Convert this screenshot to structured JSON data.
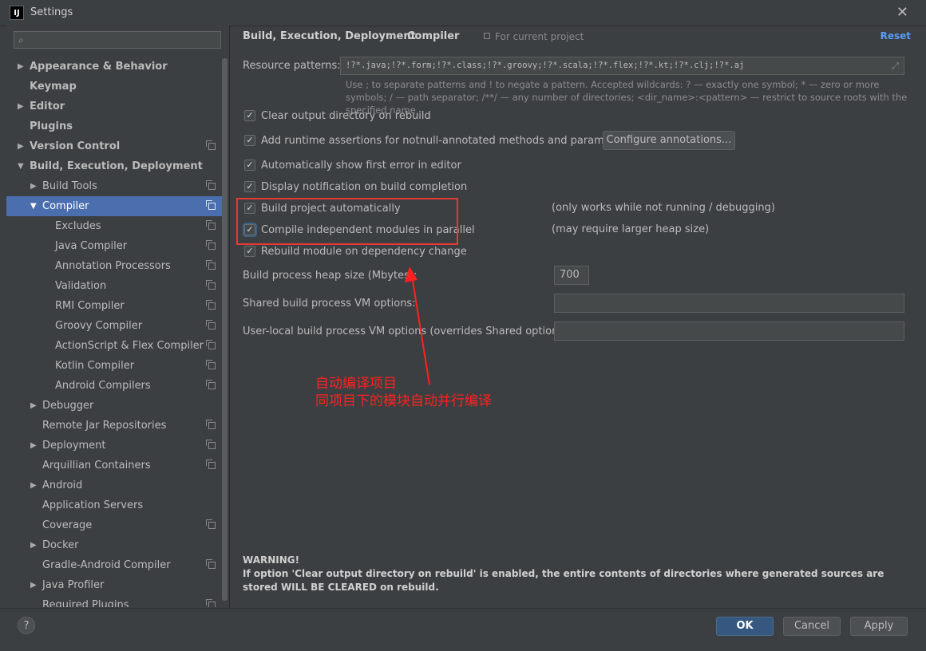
{
  "window": {
    "title": "Settings",
    "app_icon": "IJ"
  },
  "sidebar": {
    "search_placeholder": "",
    "items": [
      {
        "label": "Appearance & Behavior",
        "level": 0,
        "bold": true,
        "arrow": "▶",
        "copy": false,
        "selected": false
      },
      {
        "label": "Keymap",
        "level": 0,
        "bold": true,
        "arrow": "",
        "copy": false,
        "selected": false
      },
      {
        "label": "Editor",
        "level": 0,
        "bold": true,
        "arrow": "▶",
        "copy": false,
        "selected": false
      },
      {
        "label": "Plugins",
        "level": 0,
        "bold": true,
        "arrow": "",
        "copy": false,
        "selected": false
      },
      {
        "label": "Version Control",
        "level": 0,
        "bold": true,
        "arrow": "▶",
        "copy": true,
        "selected": false
      },
      {
        "label": "Build, Execution, Deployment",
        "level": 0,
        "bold": true,
        "arrow": "▼",
        "copy": false,
        "selected": false
      },
      {
        "label": "Build Tools",
        "level": 1,
        "bold": false,
        "arrow": "▶",
        "copy": true,
        "selected": false
      },
      {
        "label": "Compiler",
        "level": 1,
        "bold": false,
        "arrow": "▼",
        "copy": true,
        "selected": true
      },
      {
        "label": "Excludes",
        "level": 2,
        "bold": false,
        "arrow": "",
        "copy": true,
        "selected": false
      },
      {
        "label": "Java Compiler",
        "level": 2,
        "bold": false,
        "arrow": "",
        "copy": true,
        "selected": false
      },
      {
        "label": "Annotation Processors",
        "level": 2,
        "bold": false,
        "arrow": "",
        "copy": true,
        "selected": false
      },
      {
        "label": "Validation",
        "level": 2,
        "bold": false,
        "arrow": "",
        "copy": true,
        "selected": false
      },
      {
        "label": "RMI Compiler",
        "level": 2,
        "bold": false,
        "arrow": "",
        "copy": true,
        "selected": false
      },
      {
        "label": "Groovy Compiler",
        "level": 2,
        "bold": false,
        "arrow": "",
        "copy": true,
        "selected": false
      },
      {
        "label": "ActionScript & Flex Compiler",
        "level": 2,
        "bold": false,
        "arrow": "",
        "copy": true,
        "selected": false
      },
      {
        "label": "Kotlin Compiler",
        "level": 2,
        "bold": false,
        "arrow": "",
        "copy": true,
        "selected": false
      },
      {
        "label": "Android Compilers",
        "level": 2,
        "bold": false,
        "arrow": "",
        "copy": true,
        "selected": false
      },
      {
        "label": "Debugger",
        "level": 1,
        "bold": false,
        "arrow": "▶",
        "copy": false,
        "selected": false
      },
      {
        "label": "Remote Jar Repositories",
        "level": 1,
        "bold": false,
        "arrow": "",
        "copy": true,
        "selected": false
      },
      {
        "label": "Deployment",
        "level": 1,
        "bold": false,
        "arrow": "▶",
        "copy": true,
        "selected": false
      },
      {
        "label": "Arquillian Containers",
        "level": 1,
        "bold": false,
        "arrow": "",
        "copy": true,
        "selected": false
      },
      {
        "label": "Android",
        "level": 1,
        "bold": false,
        "arrow": "▶",
        "copy": false,
        "selected": false
      },
      {
        "label": "Application Servers",
        "level": 1,
        "bold": false,
        "arrow": "",
        "copy": false,
        "selected": false
      },
      {
        "label": "Coverage",
        "level": 1,
        "bold": false,
        "arrow": "",
        "copy": true,
        "selected": false
      },
      {
        "label": "Docker",
        "level": 1,
        "bold": false,
        "arrow": "▶",
        "copy": false,
        "selected": false
      },
      {
        "label": "Gradle-Android Compiler",
        "level": 1,
        "bold": false,
        "arrow": "",
        "copy": true,
        "selected": false
      },
      {
        "label": "Java Profiler",
        "level": 1,
        "bold": false,
        "arrow": "▶",
        "copy": false,
        "selected": false
      },
      {
        "label": "Required Plugins",
        "level": 1,
        "bold": false,
        "arrow": "",
        "copy": true,
        "selected": false
      }
    ]
  },
  "header": {
    "breadcrumb_parent": "Build, Execution, Deployment",
    "breadcrumb_sep": "›",
    "breadcrumb_current": "Compiler",
    "scope_label": "For current project",
    "reset_label": "Reset"
  },
  "resource": {
    "label": "Resource patterns:",
    "value": "!?*.java;!?*.form;!?*.class;!?*.groovy;!?*.scala;!?*.flex;!?*.kt;!?*.clj;!?*.aj",
    "expand_icon": "⤢",
    "hint": "Use ; to separate patterns and ! to negate a pattern. Accepted wildcards: ? — exactly one symbol; * — zero or more symbols; / — path separator; /**/ — any number of directories; <dir_name>:<pattern> — restrict to source roots with the specified name"
  },
  "options": [
    {
      "label": "Clear output directory on rebuild",
      "checked": true
    },
    {
      "label": "Add runtime assertions for notnull-annotated methods and parameters",
      "checked": true
    },
    {
      "label": "Automatically show first error in editor",
      "checked": true
    },
    {
      "label": "Display notification on build completion",
      "checked": true
    },
    {
      "label": "Build project automatically",
      "checked": true
    },
    {
      "label": "Compile independent modules in parallel",
      "checked": true
    },
    {
      "label": "Rebuild module on dependency change",
      "checked": true
    }
  ],
  "configure_button": "Configure annotations...",
  "notes": {
    "build_auto": "(only works while not running / debugging)",
    "parallel": "(may require larger heap size)"
  },
  "heap": {
    "label": "Build process heap size (Mbytes):",
    "value": "700"
  },
  "shared_vm": {
    "label": "Shared build process VM options:",
    "value": ""
  },
  "user_vm": {
    "label": "User-local build process VM options (overrides Shared options):",
    "value": ""
  },
  "annotation": {
    "line1": "自动编译项目",
    "line2": "同项目下的模块自动并行编译",
    "color": "#ff2020"
  },
  "warning": {
    "title": "WARNING!",
    "body": "If option 'Clear output directory on rebuild' is enabled, the entire contents of directories where generated sources are stored WILL BE CLEARED on rebuild."
  },
  "footer": {
    "help": "?",
    "ok": "OK",
    "cancel": "Cancel",
    "apply": "Apply"
  },
  "colors": {
    "selection": "#4b6eaf",
    "accent_link": "#589df6",
    "primary_button": "#365880",
    "highlight_box": "#e53935"
  }
}
